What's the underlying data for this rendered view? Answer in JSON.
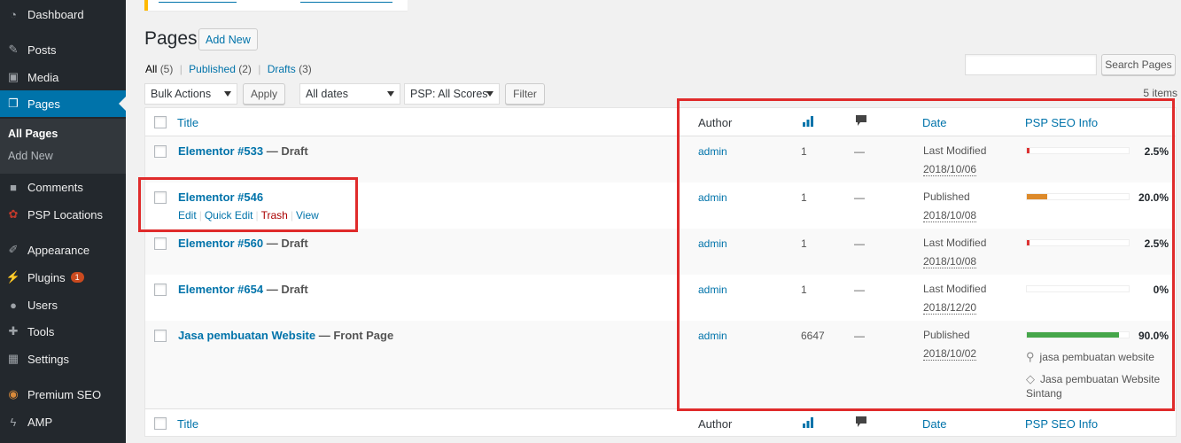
{
  "sidebar": {
    "items": [
      {
        "label": "Dashboard",
        "icon": "dashboard-icon"
      },
      {
        "label": "Posts",
        "icon": "pin-icon"
      },
      {
        "label": "Media",
        "icon": "media-icon"
      },
      {
        "label": "Pages",
        "icon": "pages-icon"
      },
      {
        "label": "Comments",
        "icon": "comment-icon"
      },
      {
        "label": "PSP Locations",
        "icon": "locations-icon"
      },
      {
        "label": "Appearance",
        "icon": "brush-icon"
      },
      {
        "label": "Plugins",
        "icon": "plugin-icon",
        "badge": "1"
      },
      {
        "label": "Users",
        "icon": "user-icon"
      },
      {
        "label": "Tools",
        "icon": "wrench-icon"
      },
      {
        "label": "Settings",
        "icon": "settings-icon"
      },
      {
        "label": "Premium SEO",
        "icon": "seo-icon"
      },
      {
        "label": "AMP",
        "icon": "bolt-icon"
      }
    ],
    "submenu": {
      "all_pages": "All Pages",
      "add_new": "Add New"
    }
  },
  "header": {
    "title": "Pages",
    "add_new": "Add New"
  },
  "filters": {
    "all": "All",
    "all_count": "(5)",
    "published": "Published",
    "published_count": "(2)",
    "drafts": "Drafts",
    "drafts_count": "(3)",
    "sep": "|"
  },
  "search": {
    "button": "Search Pages"
  },
  "toolbar": {
    "bulk_actions": "Bulk Actions",
    "apply": "Apply",
    "dates": "All dates",
    "scores": "PSP: All Scores",
    "filter": "Filter",
    "items": "5 items"
  },
  "columns": {
    "title": "Title",
    "author": "Author",
    "date": "Date",
    "seo": "PSP SEO Info"
  },
  "rows": [
    {
      "title": "Elementor #533",
      "state": " — Draft",
      "author": "admin",
      "views": "1",
      "comments": "—",
      "date_label": "Last Modified",
      "date": "2018/10/06",
      "score": 2.5,
      "score_text": "2.5%"
    },
    {
      "title": "Elementor #546",
      "state": "",
      "author": "admin",
      "views": "1",
      "comments": "—",
      "date_label": "Published",
      "date": "2018/10/08",
      "score": 20.0,
      "score_text": "20.0%",
      "actions": {
        "edit": "Edit",
        "quick_edit": "Quick Edit",
        "trash": "Trash",
        "view": "View",
        "sep": "|"
      }
    },
    {
      "title": "Elementor #560",
      "state": " — Draft",
      "author": "admin",
      "views": "1",
      "comments": "—",
      "date_label": "Last Modified",
      "date": "2018/10/08",
      "score": 2.5,
      "score_text": "2.5%"
    },
    {
      "title": "Elementor #654",
      "state": " — Draft",
      "author": "admin",
      "views": "1",
      "comments": "—",
      "date_label": "Last Modified",
      "date": "2018/12/20",
      "score": 0,
      "score_text": "0%"
    },
    {
      "title": "Jasa pembuatan Website",
      "state": " — Front Page",
      "author": "admin",
      "views": "6647",
      "comments": "—",
      "date_label": "Published",
      "date": "2018/10/02",
      "score": 90.0,
      "score_text": "90.0%",
      "keyword": "jasa pembuatan website",
      "tag_line1": "Jasa pembuatan Website",
      "tag_line2": "Sintang"
    }
  ],
  "colors": {
    "accent": "#0073aa",
    "sidebar": "#23282d",
    "highlight": "#e02b2b",
    "score_low": "#dc3232",
    "score_mid": "#dd8a2a",
    "score_high": "#46a64a"
  }
}
